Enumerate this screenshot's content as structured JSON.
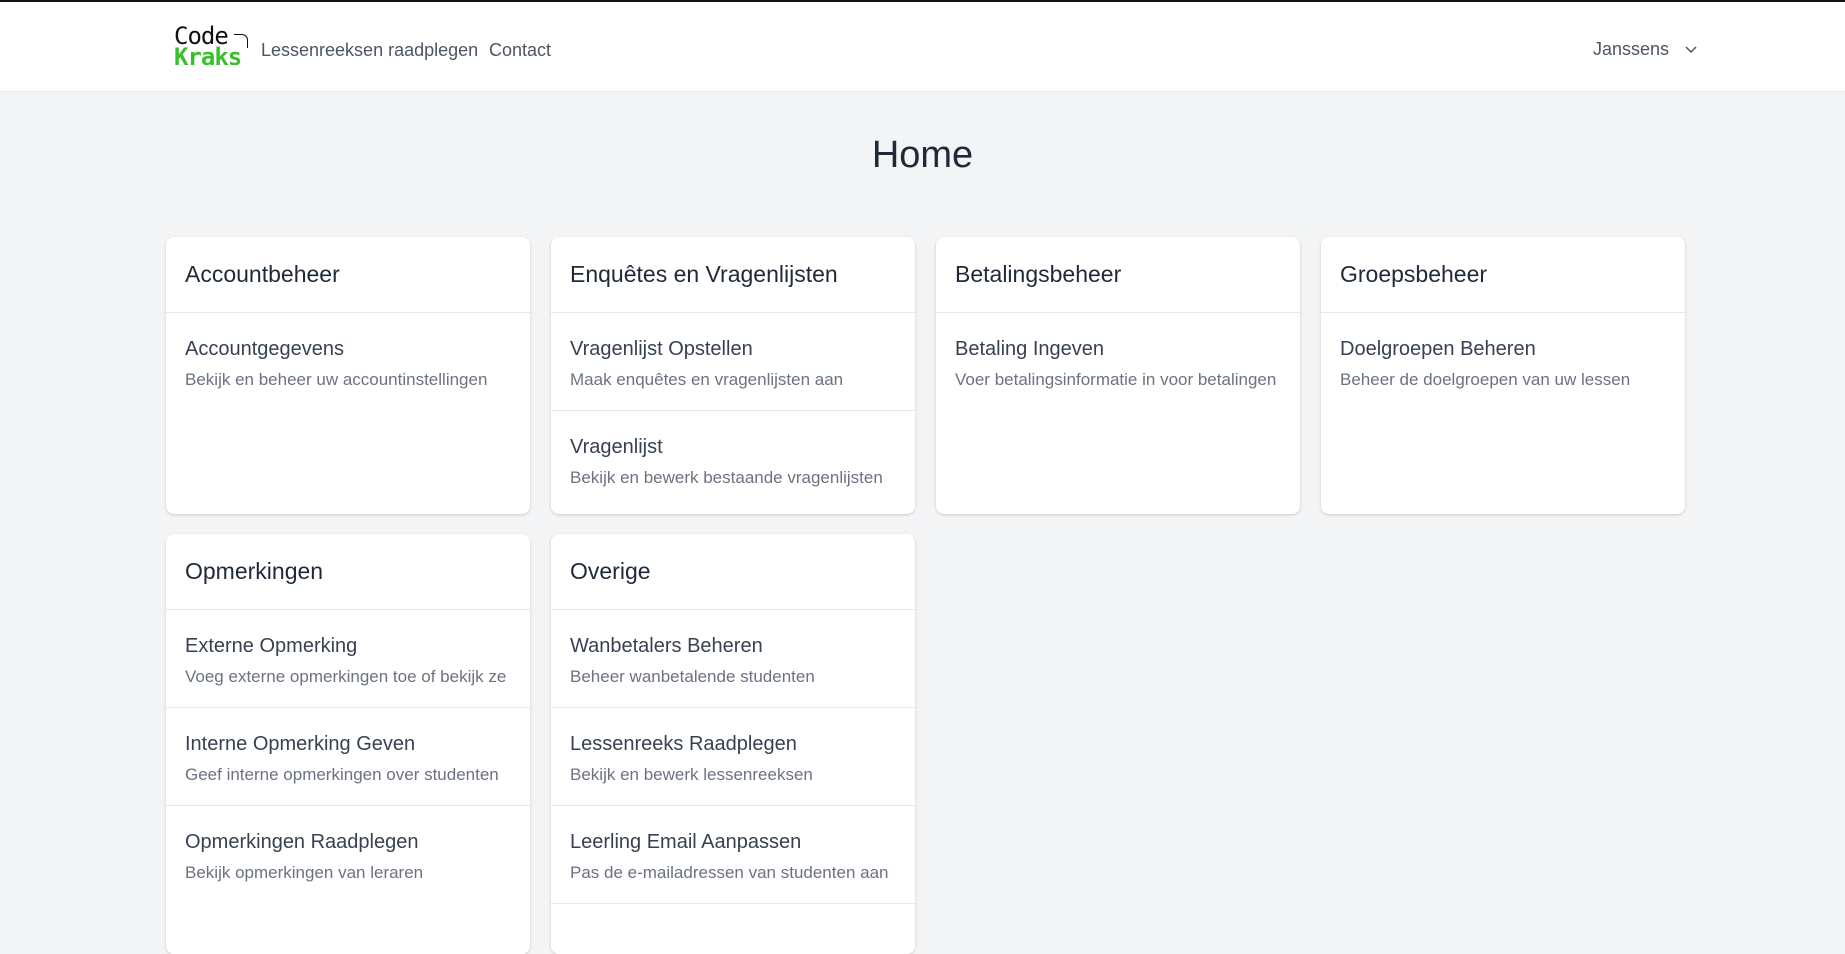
{
  "logo": {
    "line1": "Code",
    "line2": "Kraks"
  },
  "nav": {
    "links": [
      "Lessenreeksen raadplegen",
      "Contact"
    ]
  },
  "user": {
    "name": "Janssens"
  },
  "page": {
    "title": "Home"
  },
  "cards": [
    {
      "title": "Accountbeheer",
      "items": [
        {
          "title": "Accountgegevens",
          "desc": "Bekijk en beheer uw accountinstellingen"
        }
      ]
    },
    {
      "title": "Enquêtes en Vragenlijsten",
      "items": [
        {
          "title": "Vragenlijst Opstellen",
          "desc": "Maak enquêtes en vragenlijsten aan"
        },
        {
          "title": "Vragenlijst",
          "desc": "Bekijk en bewerk bestaande vragenlijsten"
        }
      ]
    },
    {
      "title": "Betalingsbeheer",
      "items": [
        {
          "title": "Betaling Ingeven",
          "desc": "Voer betalingsinformatie in voor betalingen"
        }
      ]
    },
    {
      "title": "Groepsbeheer",
      "items": [
        {
          "title": "Doelgroepen Beheren",
          "desc": "Beheer de doelgroepen van uw lessen"
        }
      ]
    },
    {
      "title": "Opmerkingen",
      "items": [
        {
          "title": "Externe Opmerking",
          "desc": "Voeg externe opmerkingen toe of bekijk ze"
        },
        {
          "title": "Interne Opmerking Geven",
          "desc": "Geef interne opmerkingen over studenten"
        },
        {
          "title": "Opmerkingen Raadplegen",
          "desc": "Bekijk opmerkingen van leraren"
        }
      ]
    },
    {
      "title": "Overige",
      "items": [
        {
          "title": "Wanbetalers Beheren",
          "desc": "Beheer wanbetalende studenten"
        },
        {
          "title": "Lessenreeks Raadplegen",
          "desc": "Bekijk en bewerk lessenreeksen"
        },
        {
          "title": "Leerling Email Aanpassen",
          "desc": "Pas de e-mailadressen van studenten aan"
        }
      ]
    }
  ]
}
